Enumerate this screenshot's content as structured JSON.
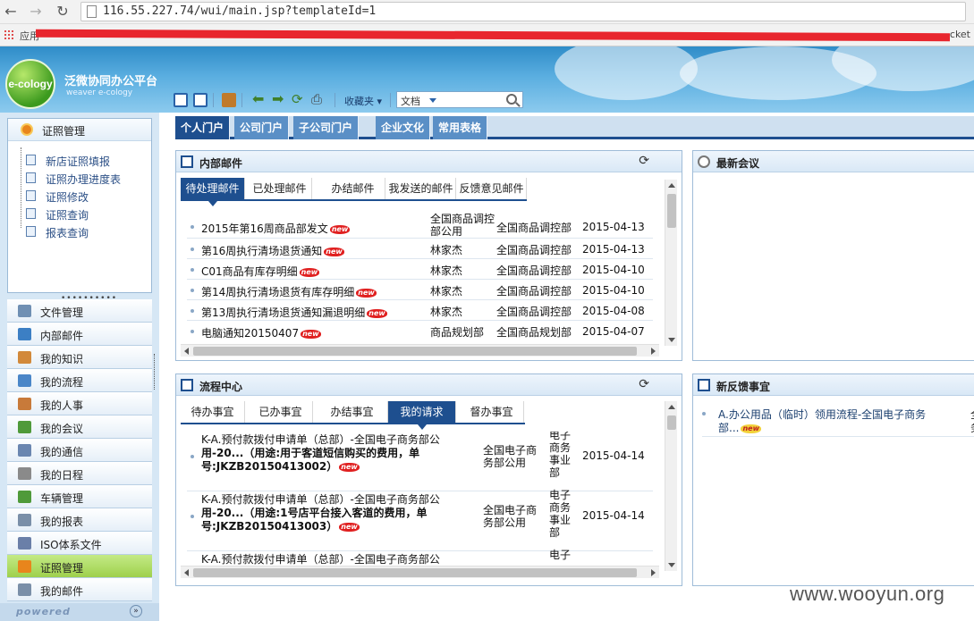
{
  "browser": {
    "url": "116.55.227.74/wui/main.jsp?templateId=1",
    "bookmarks_apps_label": "应用",
    "bookmarks_tail": "cket"
  },
  "app": {
    "logo_text": "e-cology",
    "title": "泛微协同办公平台",
    "subtitle": "weaver e-cology"
  },
  "toolbar": {
    "favorites_label": "收藏夹",
    "search_scope": "文档",
    "search_placeholder": ""
  },
  "sidebar": {
    "module_title": "证照管理",
    "tree_items": [
      "新店证照填报",
      "证照办理进度表",
      "证照修改",
      "证照查询",
      "报表查询"
    ],
    "menu_items": [
      {
        "label": "文件管理",
        "icon": "file-icon",
        "color": "#6f8fb3"
      },
      {
        "label": "内部邮件",
        "icon": "mail-icon",
        "color": "#3c7fc4"
      },
      {
        "label": "我的知识",
        "icon": "knowledge-icon",
        "color": "#d2893a"
      },
      {
        "label": "我的流程",
        "icon": "workflow-icon",
        "color": "#4a86c8"
      },
      {
        "label": "我的人事",
        "icon": "person-icon",
        "color": "#c87a3a"
      },
      {
        "label": "我的会议",
        "icon": "meeting-icon",
        "color": "#4f9a3a"
      },
      {
        "label": "我的通信",
        "icon": "contact-icon",
        "color": "#6a86b0"
      },
      {
        "label": "我的日程",
        "icon": "calendar-icon",
        "color": "#8a8a8a"
      },
      {
        "label": "车辆管理",
        "icon": "car-icon",
        "color": "#4f9a3a"
      },
      {
        "label": "我的报表",
        "icon": "report-icon",
        "color": "#7a8fa8"
      },
      {
        "label": "ISO体系文件",
        "icon": "iso-icon",
        "color": "#6a7fa8"
      },
      {
        "label": "证照管理",
        "icon": "license-icon",
        "color": "#e8851c",
        "active": true
      },
      {
        "label": "我的邮件",
        "icon": "inbox-icon",
        "color": "#7a8fa8"
      }
    ],
    "powered_label": "powered"
  },
  "portal_tabs": [
    "个人门户",
    "公司门户",
    "子公司门户",
    "企业文化",
    "常用表格"
  ],
  "mail_portlet": {
    "title": "内部邮件",
    "tabs": [
      "待处理邮件",
      "已处理邮件",
      "办结邮件",
      "我发送的邮件",
      "反馈意见邮件"
    ],
    "active_tab": 0,
    "new_label": "new",
    "rows": [
      {
        "subject": "2015年第16周商品部发文",
        "sender": "全国商品调控部公用",
        "dept": "全国商品调控部",
        "date": "2015-04-13"
      },
      {
        "subject": "第16周执行清场退货通知",
        "sender": "林家杰",
        "dept": "全国商品调控部",
        "date": "2015-04-13"
      },
      {
        "subject": "C01商品有库存明细",
        "sender": "林家杰",
        "dept": "全国商品调控部",
        "date": "2015-04-10"
      },
      {
        "subject": "第14周执行清场退货有库存明细",
        "sender": "林家杰",
        "dept": "全国商品调控部",
        "date": "2015-04-10"
      },
      {
        "subject": "第13周执行清场退货通知漏退明细",
        "sender": "林家杰",
        "dept": "全国商品调控部",
        "date": "2015-04-08"
      },
      {
        "subject": "电脑通知20150407",
        "sender": "商品规划部",
        "dept": "全国商品规划部",
        "date": "2015-04-07"
      }
    ]
  },
  "meeting_portlet": {
    "title": "最新会议"
  },
  "workflow_portlet": {
    "title": "流程中心",
    "tabs": [
      "待办事宜",
      "已办事宜",
      "办结事宜",
      "我的请求",
      "督办事宜"
    ],
    "active_tab": 3,
    "rows": [
      {
        "line1": "K-A.预付款拨付申请单（总部）-全国电子商务部公",
        "line2": "用-20...（用途:用于客道短信购买的费用，单",
        "line3": "号:JKZB20150413002）",
        "creator": "全国电子商务部公用",
        "dept": "电子商务事业部",
        "date": "2015-04-14"
      },
      {
        "line1": "K-A.预付款拨付申请单（总部）-全国电子商务部公",
        "line2": "用-20...（用途:1号店平台接入客道的费用，单",
        "line3": "号:JKZB20150413003）",
        "creator": "全国电子商务部公用",
        "dept": "电子商务事业部",
        "date": "2015-04-14"
      },
      {
        "line1": "K-A.预付款拨付申请单（总部）-全国电子商务部公",
        "line2": "",
        "line3": "",
        "creator": "",
        "dept": "电子",
        "date": ""
      }
    ]
  },
  "feedback_portlet": {
    "title": "新反馈事宜",
    "item_line1": "A.办公用品（临时）领用流程-全国电子商务",
    "item_line2": "部...",
    "item_side1": "全",
    "item_side2": "务"
  },
  "watermark": "www.wooyun.org"
}
